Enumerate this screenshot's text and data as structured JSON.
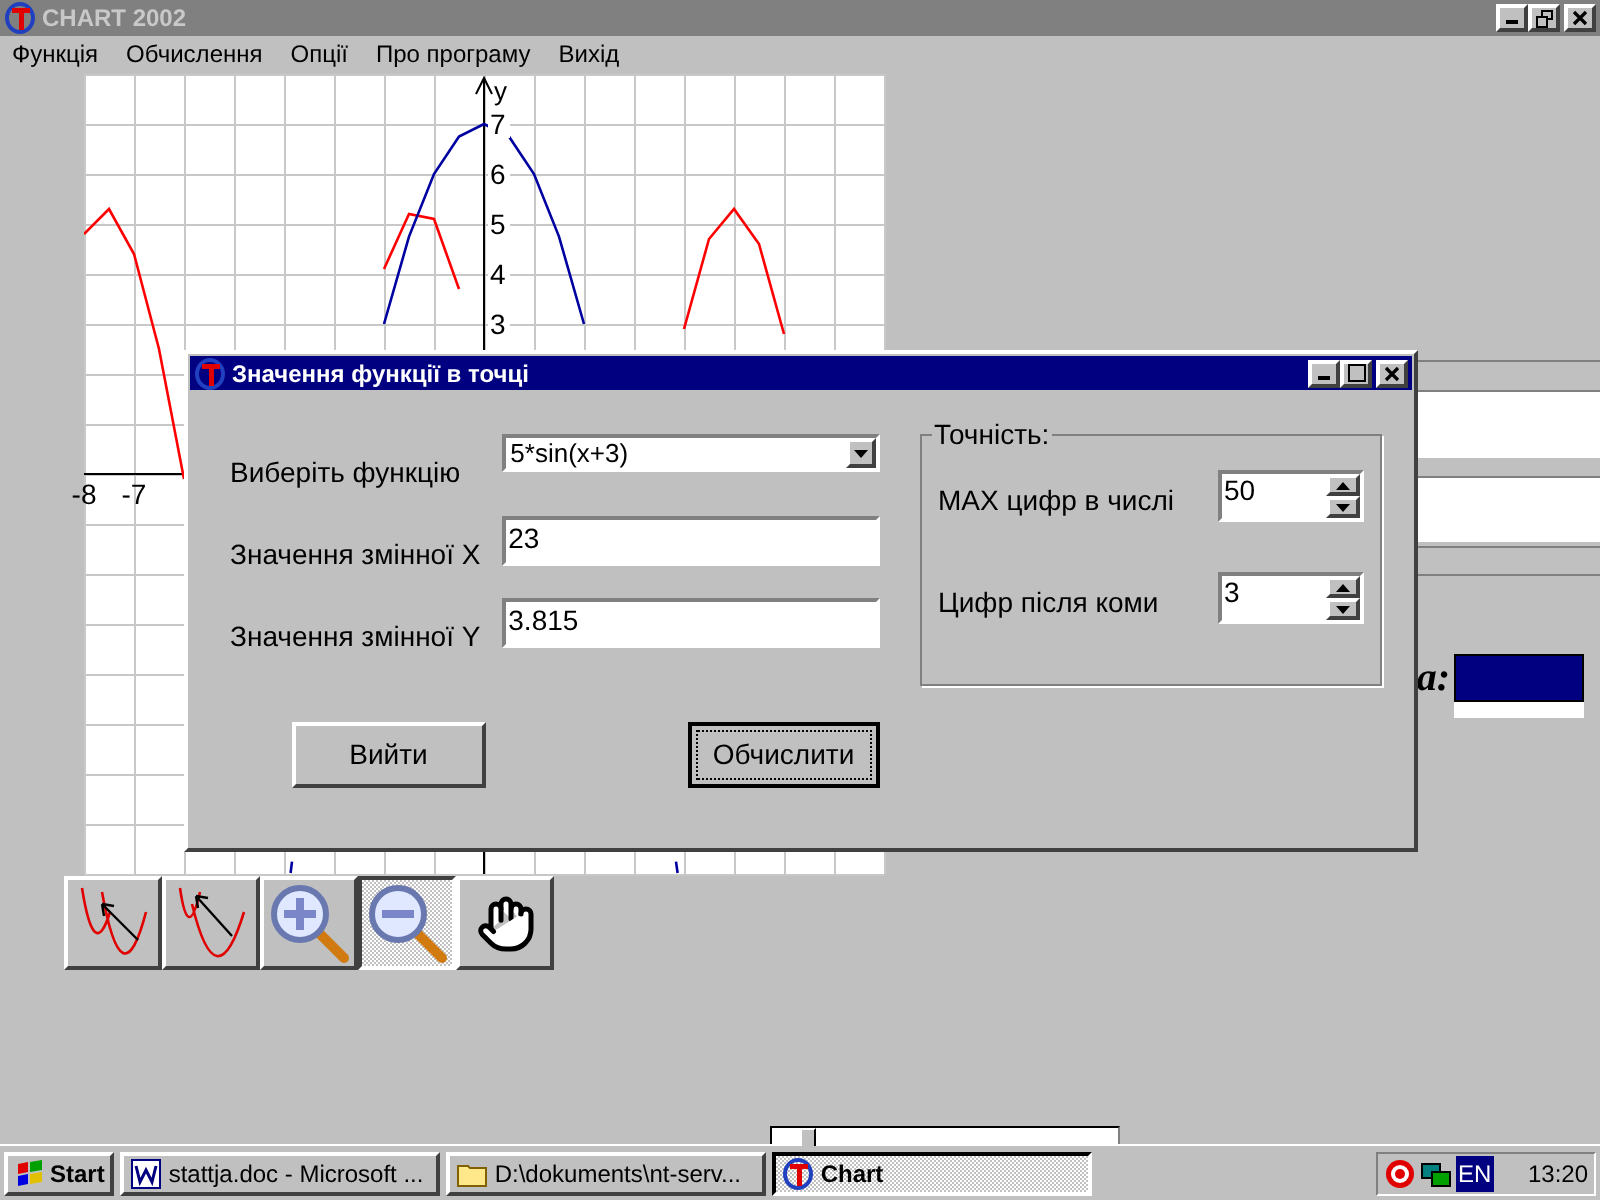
{
  "window": {
    "title": "CHART 2002"
  },
  "menu": [
    "Функція",
    "Обчислення",
    "Опції",
    "Про програму",
    "Вихід"
  ],
  "chart": {
    "chart_data": {
      "type": "line",
      "ylabel": "y",
      "x": [
        -8,
        -7.5,
        -7,
        -6.5,
        -6,
        -3.87,
        -3.84,
        -2,
        -1.5,
        -1,
        -0.5,
        0,
        0.5,
        1,
        1.5,
        2,
        3.84,
        3.87,
        4,
        4.5,
        5,
        5.5,
        6
      ],
      "series": [
        {
          "color": "#ff0000",
          "values": [
            4.8,
            5.3,
            4.4,
            2.5,
            -0.1,
            null,
            null,
            4.1,
            5.2,
            5.1,
            3.7,
            null,
            null,
            null,
            null,
            null,
            null,
            null,
            2.9,
            4.7,
            5.3,
            4.6,
            2.8
          ]
        },
        {
          "color": "#0000a0",
          "values": [
            null,
            null,
            null,
            null,
            null,
            -7.98,
            -7.75,
            3,
            4.75,
            6,
            6.75,
            7,
            6.75,
            6,
            4.75,
            3,
            -7.75,
            -7.98,
            null,
            null,
            null,
            null,
            null
          ]
        }
      ],
      "grid": true,
      "xlim": [
        -8,
        8
      ],
      "ylim": [
        -8,
        8
      ],
      "xticks": [
        {
          "value": -8,
          "label": "-8"
        },
        {
          "value": -7,
          "label": "-7"
        }
      ],
      "yticks": [
        3,
        4,
        5,
        6,
        7
      ]
    }
  },
  "toolbar": [
    {
      "kind": "trace-left",
      "selected": false
    },
    {
      "kind": "trace-right",
      "selected": false
    },
    {
      "kind": "zoom-in",
      "selected": false
    },
    {
      "kind": "zoom-out",
      "selected": true
    },
    {
      "kind": "pan",
      "selected": false
    }
  ],
  "side_panel": {
    "label": "а:"
  },
  "dialog": {
    "title": "Значення функції в точці",
    "fields": [
      {
        "kind": "combo",
        "label": "Виберіть функцію",
        "value": "5*sin(x+3)"
      },
      {
        "kind": "input",
        "label": "Значення змінної X",
        "value": "23"
      },
      {
        "kind": "input",
        "label": "Значення змінної Y",
        "value": "3.815"
      }
    ],
    "buttons": [
      {
        "label": "Вийти",
        "default": false
      },
      {
        "label": "Обчислити",
        "default": true
      }
    ],
    "precision": {
      "title": "Точність:",
      "spinners": [
        {
          "label": "MAX цифр в числі",
          "value": "50"
        },
        {
          "label": "Цифр після коми",
          "value": "3"
        }
      ]
    }
  },
  "slider": {
    "level": 0.08
  },
  "taskbar": {
    "start": "Start",
    "tasks": [
      {
        "kind": "word",
        "label": "stattja.doc - Microsoft ...",
        "selected": false
      },
      {
        "kind": "folder",
        "label": "D:\\dokuments\\nt-serv...",
        "selected": false
      },
      {
        "kind": "chart",
        "label": "Chart",
        "selected": true
      }
    ],
    "language": "EN",
    "clock": "13:20"
  }
}
